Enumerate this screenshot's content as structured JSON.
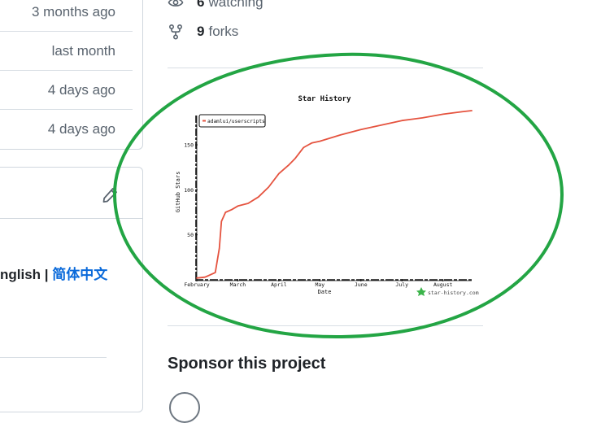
{
  "commits": {
    "times": [
      "3 months ago",
      "last month",
      "4 days ago",
      "4 days ago"
    ]
  },
  "readme": {
    "lang_english": "nglish | ",
    "lang_chinese": "简体中文"
  },
  "about": {
    "watching_count": "6",
    "watching_label": "watching",
    "forks_count": "9",
    "forks_label": "forks"
  },
  "sponsor": {
    "title": "Sponsor this project"
  },
  "icons": {
    "watch": "eye-icon",
    "fork": "repo-forked-icon",
    "edit": "pencil-icon",
    "brand": "star-history-logo-icon"
  },
  "colors": {
    "series": "#e5533f",
    "highlight_circle": "#23a544",
    "link": "#0969da"
  },
  "chart_data": {
    "type": "line",
    "title": "Star History",
    "xlabel": "Date",
    "ylabel": "GitHub Stars",
    "legend": "top-left",
    "watermark": "star-history.com",
    "x_ticks": [
      "February",
      "March",
      "April",
      "May",
      "June",
      "July",
      "August"
    ],
    "y_ticks": [
      50,
      100,
      150
    ],
    "ylim": [
      0,
      188
    ],
    "x_months_range": [
      0,
      6.7
    ],
    "series": [
      {
        "name": "adamlui/userscripts",
        "x": [
          0,
          0.2,
          0.45,
          0.55,
          0.6,
          0.7,
          0.85,
          1.0,
          1.25,
          1.5,
          1.75,
          2.0,
          2.25,
          2.4,
          2.6,
          2.8,
          3.0,
          3.5,
          4.0,
          4.5,
          5.0,
          5.5,
          6.0,
          6.5,
          6.7
        ],
        "y": [
          2,
          3,
          8,
          35,
          65,
          75,
          78,
          82,
          85,
          92,
          103,
          118,
          128,
          135,
          147,
          152,
          154,
          161,
          167,
          172,
          177,
          180,
          184,
          187,
          188
        ]
      }
    ]
  }
}
